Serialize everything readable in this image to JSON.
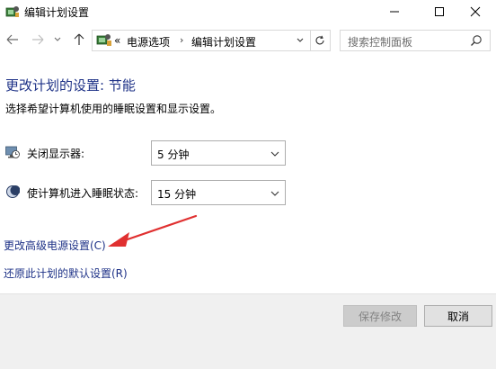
{
  "window": {
    "title": "编辑计划设置"
  },
  "nav": {
    "breadcrumb_prefix": "«",
    "breadcrumb": [
      "电源选项",
      "编辑计划设置"
    ],
    "separator": "›",
    "search_placeholder": "搜索控制面板"
  },
  "content": {
    "page_title": "更改计划的设置: 节能",
    "subtitle": "选择希望计算机使用的睡眠设置和显示设置。",
    "settings": [
      {
        "label": "关闭显示器:",
        "value": "5 分钟",
        "icon": "monitor-clock-icon"
      },
      {
        "label": "使计算机进入睡眠状态:",
        "value": "15 分钟",
        "icon": "sleep-moon-icon"
      }
    ],
    "links": {
      "advanced": "更改高级电源设置(C)",
      "restore": "还原此计划的默认设置(R)"
    }
  },
  "buttons": {
    "save": "保存修改",
    "cancel": "取消"
  },
  "colors": {
    "title_blue": "#1e3287",
    "link_blue": "#1e3287",
    "footer_bg": "#f0f0f0",
    "annotation_red": "#e03030"
  }
}
